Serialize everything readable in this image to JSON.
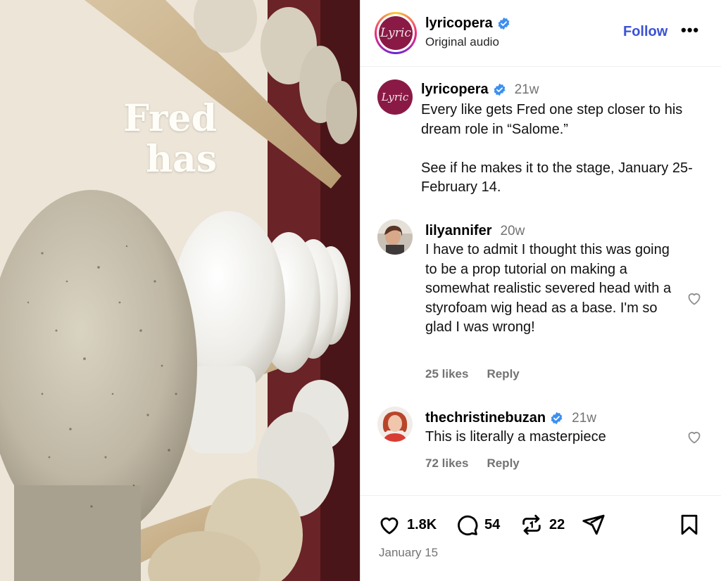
{
  "media": {
    "overlay_line1": "Fred",
    "overlay_line2": "has"
  },
  "header": {
    "avatar_text": "Lyric",
    "username": "lyricopera",
    "subtitle": "Original audio",
    "follow_label": "Follow",
    "more_label": "•••"
  },
  "caption": {
    "avatar_text": "Lyric",
    "username": "lyricopera",
    "time": "21w",
    "text": "Every like gets Fred one step closer to his dream role in “Salome.”\n\nSee if he makes it to the stage, January 25-February 14."
  },
  "comments": [
    {
      "username": "lilyannifer",
      "time": "20w",
      "text": "I have to admit I thought this was going to be a prop tutorial on making a somewhat realistic severed head with a styrofoam wig head as a base. I'm so glad I was wrong!",
      "likes": "25 likes",
      "reply": "Reply"
    },
    {
      "username": "thechristinebuzan",
      "time": "21w",
      "text": "This is literally a masterpiece",
      "likes": "72 likes",
      "reply": "Reply"
    }
  ],
  "actions": {
    "likes": "1.8K",
    "comments": "54",
    "reposts": "22",
    "date": "January 15"
  },
  "colors": {
    "verified": "#3b8ff0",
    "link": "#3a52d6",
    "brand": "#8a1a45"
  }
}
